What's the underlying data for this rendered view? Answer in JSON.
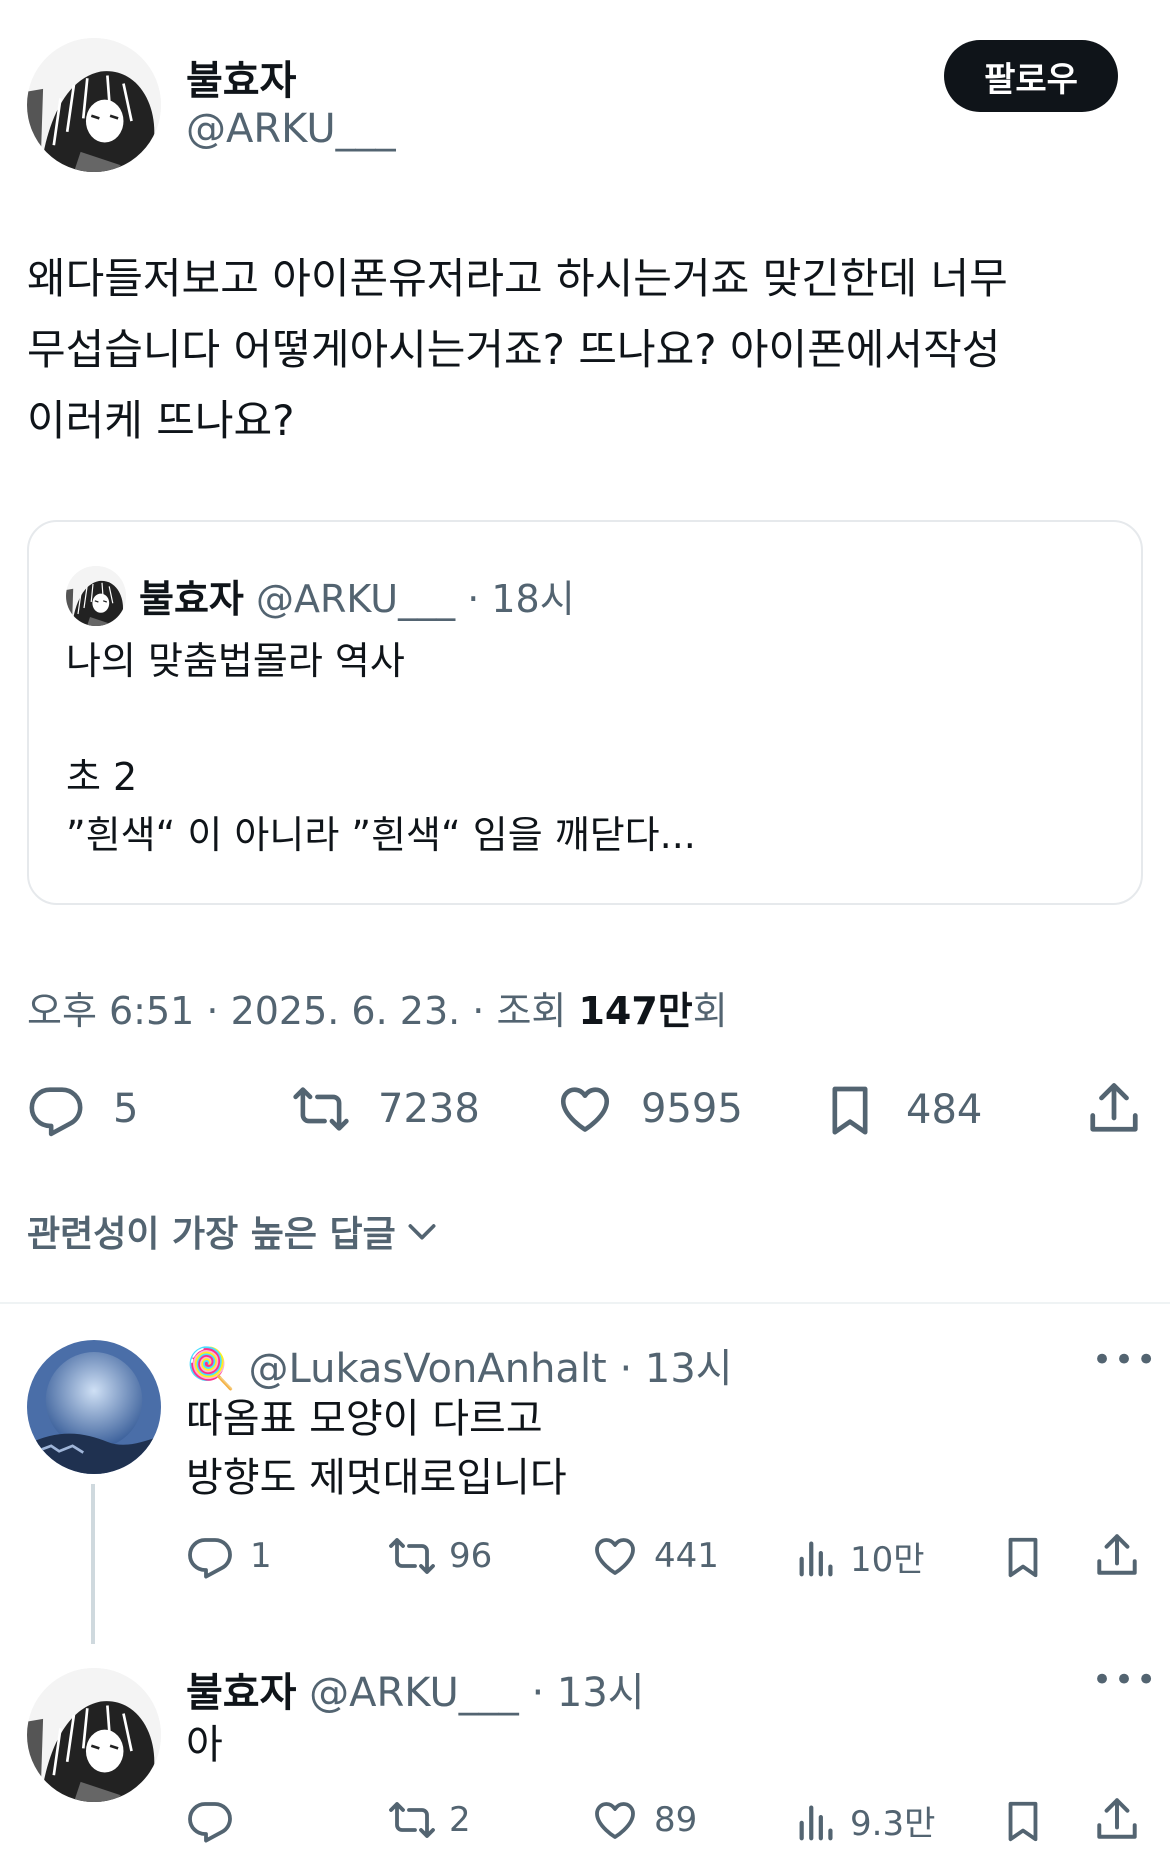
{
  "tweet": {
    "display_name": "불효자",
    "handle": "@ARKU___",
    "follow_label": "팔로우",
    "text_lines": [
      "왜다들저보고 아이폰유저라고 하시는거죠 맞긴한데 너무",
      "무섭습니다 어떻게아시는거죠? 뜨나요? 아이폰에서작성",
      "이러케 뜨나요?"
    ],
    "quote": {
      "display_name": "불효자",
      "handle": "@ARKU___",
      "time": "· 18시",
      "lines": [
        "나의 맞춤법몰라 역사",
        "",
        "초 2",
        "”흰색“ 이 아니라 ”흰색“ 임을 깨닫다..."
      ]
    },
    "meta": {
      "time": "오후 6:51 · 2025. 6. 23. · 조회 ",
      "views_bold": "147만",
      "views_suffix": "회"
    },
    "stats": {
      "replies": "5",
      "retweets": "7238",
      "likes": "9595",
      "bookmarks": "484"
    }
  },
  "replies_sort": {
    "label": "관련성이 가장 높은 답글"
  },
  "replies": [
    {
      "emoji": "🍭",
      "handle": "@LukasVonAnhalt",
      "time": "· 13시",
      "lines": [
        "따옴표 모양이 다르고",
        "방향도 제멋대로입니다"
      ],
      "stats": {
        "replies": "1",
        "retweets": "96",
        "likes": "441",
        "views": "10만"
      }
    },
    {
      "display_name": "불효자",
      "handle": "@ARKU___",
      "time": "· 13시",
      "lines": [
        "아"
      ],
      "stats": {
        "replies": "",
        "retweets": "2",
        "likes": "89",
        "views": "9.3만"
      }
    }
  ],
  "more_label": "•••",
  "colors": {
    "text": "#0f1419",
    "secondary": "#536471",
    "border": "#e6e9ec"
  },
  "icons": [
    "reply-icon",
    "retweet-icon",
    "like-icon",
    "bookmark-icon",
    "share-icon",
    "views-icon",
    "chevron-down-icon",
    "more-icon"
  ]
}
